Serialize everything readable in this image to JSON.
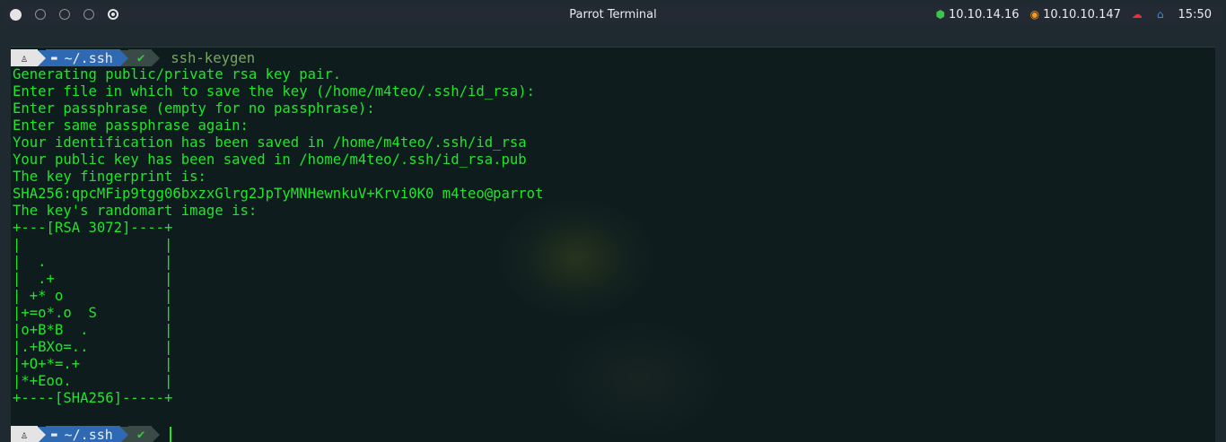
{
  "topbar": {
    "title": "Parrot Terminal",
    "vpn_ip": "10.10.14.16",
    "target_ip": "10.10.10.147",
    "clock": "15:50"
  },
  "prompt": {
    "dir": "~/.ssh",
    "status": "✔"
  },
  "terminal": {
    "command": "ssh-keygen",
    "output": [
      "Generating public/private rsa key pair.",
      "Enter file in which to save the key (/home/m4teo/.ssh/id_rsa):",
      "Enter passphrase (empty for no passphrase):",
      "Enter same passphrase again:",
      "Your identification has been saved in /home/m4teo/.ssh/id_rsa",
      "Your public key has been saved in /home/m4teo/.ssh/id_rsa.pub",
      "The key fingerprint is:",
      "SHA256:qpcMFip9tgg06bxzxGlrg2JpTyMNHewnkuV+Krvi0K0 m4teo@parrot",
      "The key's randomart image is:",
      "+---[RSA 3072]----+",
      "|                 |",
      "|  .              |",
      "|  .+             |",
      "| +* o            |",
      "|+=o*.o  S        |",
      "|o+B*B  .         |",
      "|.+BXo=..         |",
      "|+O+*=.+          |",
      "|*+Eoo.           |",
      "+----[SHA256]-----+"
    ]
  }
}
